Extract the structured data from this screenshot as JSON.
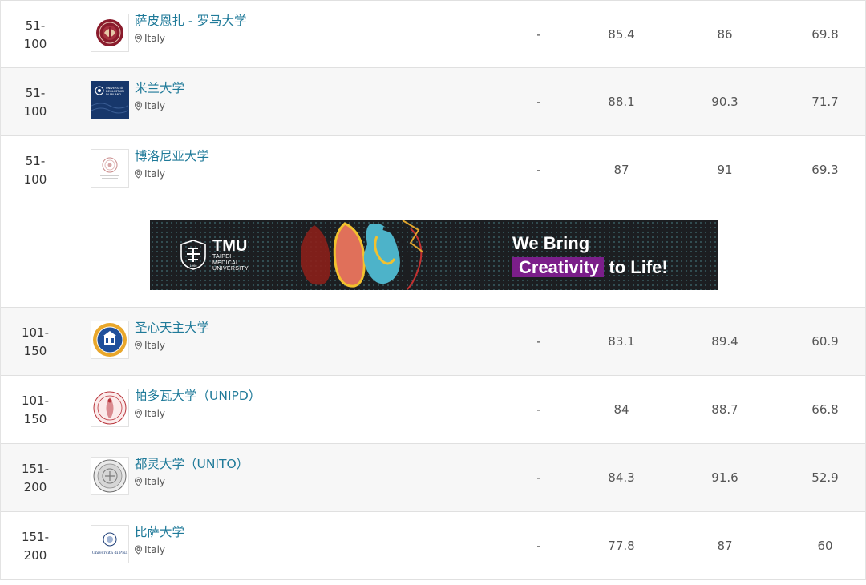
{
  "rows_top": [
    {
      "rank": [
        "51-",
        "100"
      ],
      "name": "萨皮恩扎 - 罗马大学",
      "location": "Italy",
      "c1": "-",
      "c2": "85.4",
      "c3": "86",
      "c4": "69.8"
    },
    {
      "rank": [
        "51-",
        "100"
      ],
      "name": "米兰大学",
      "location": "Italy",
      "c1": "-",
      "c2": "88.1",
      "c3": "90.3",
      "c4": "71.7"
    },
    {
      "rank": [
        "51-",
        "100"
      ],
      "name": "博洛尼亚大学",
      "location": "Italy",
      "c1": "-",
      "c2": "87",
      "c3": "91",
      "c4": "69.3"
    }
  ],
  "ad": {
    "brand": "TMU",
    "brand_sub": [
      "TAIPEI",
      "MEDICAL",
      "UNIVERSITY"
    ],
    "seal_year": "1960",
    "line1": "We Bring",
    "line2_highlight": "Creativity",
    "line2_rest": "to Life!",
    "highlight_color": "#7b1e8a"
  },
  "rows_bottom": [
    {
      "rank": [
        "101-",
        "150"
      ],
      "name": "圣心天主大学",
      "location": "Italy",
      "c1": "-",
      "c2": "83.1",
      "c3": "89.4",
      "c4": "60.9"
    },
    {
      "rank": [
        "101-",
        "150"
      ],
      "name": "帕多瓦大学（UNIPD）",
      "location": "Italy",
      "c1": "-",
      "c2": "84",
      "c3": "88.7",
      "c4": "66.8"
    },
    {
      "rank": [
        "151-",
        "200"
      ],
      "name": "都灵大学（UNITO）",
      "location": "Italy",
      "c1": "-",
      "c2": "84.3",
      "c3": "91.6",
      "c4": "52.9"
    },
    {
      "rank": [
        "151-",
        "200"
      ],
      "name": "比萨大学",
      "location": "Italy",
      "c1": "-",
      "c2": "77.8",
      "c3": "87",
      "c4": "60"
    }
  ],
  "logo_captions": {
    "milano": [
      "UNIVERSITÀ",
      "DEGLI STUDI",
      "DI MILANO"
    ],
    "pisa": "Università di Pisa"
  },
  "colors": {
    "link": "#1f7a99",
    "row_alt": "#f7f7f7",
    "border": "#e0e0e0"
  }
}
